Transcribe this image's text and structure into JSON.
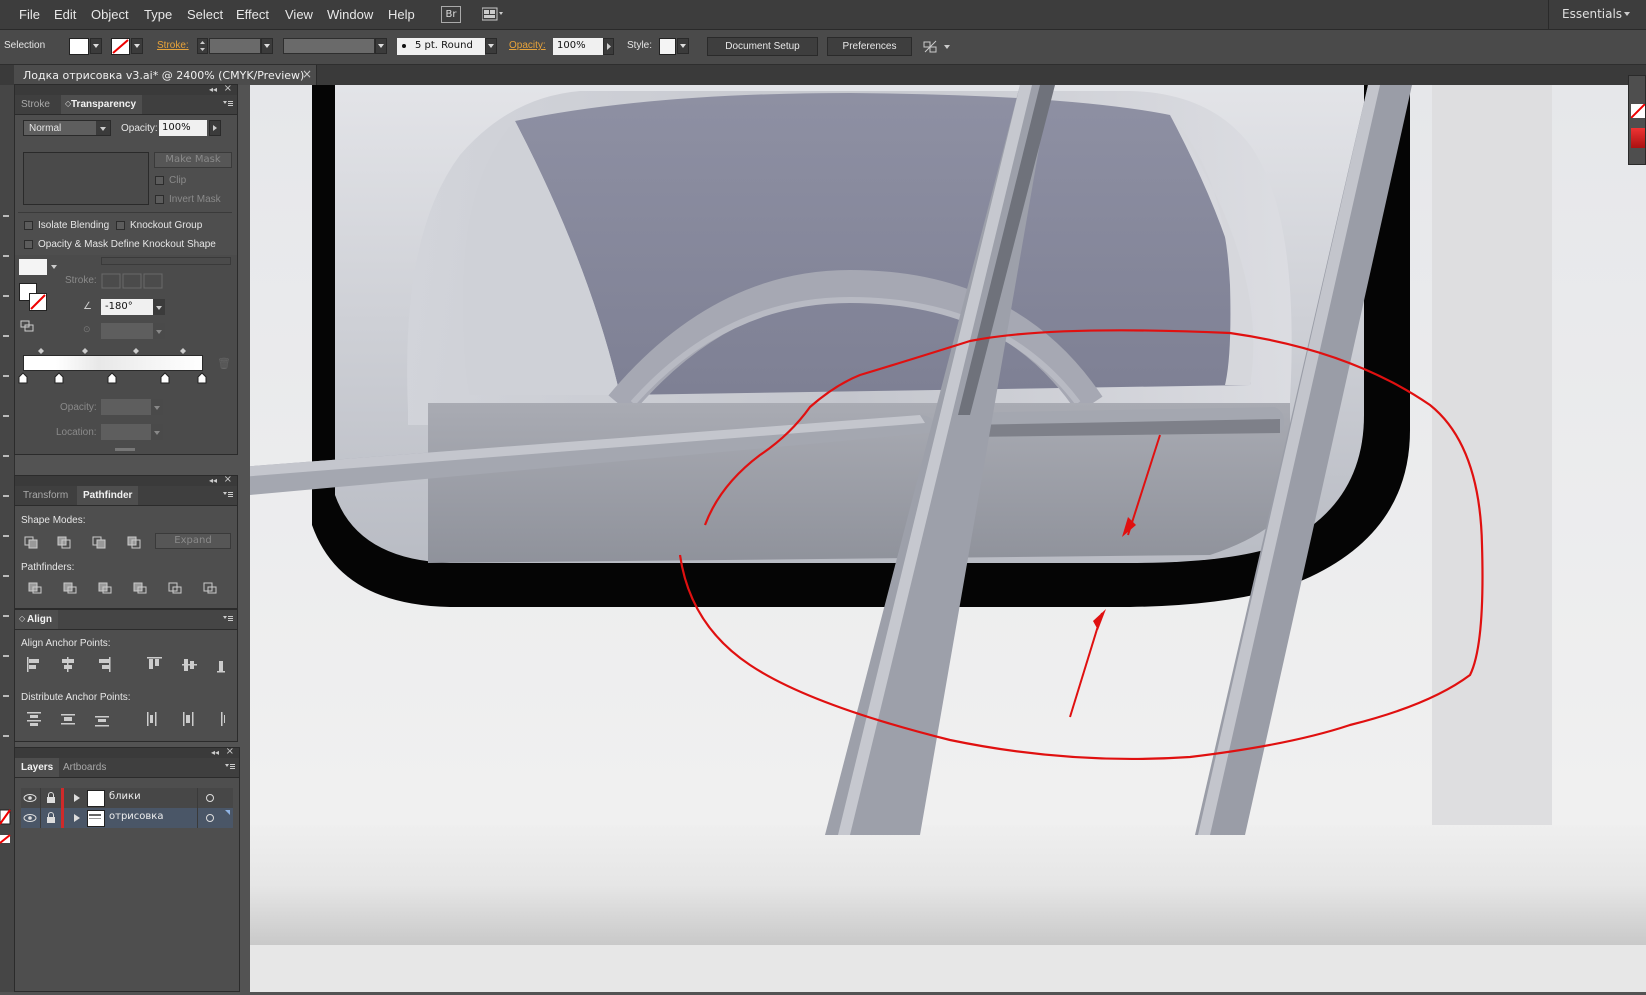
{
  "menubar": {
    "items": [
      "File",
      "Edit",
      "Object",
      "Type",
      "Select",
      "Effect",
      "View",
      "Window",
      "Help"
    ],
    "bridge": "Br",
    "workspace": "Essentials"
  },
  "controlbar": {
    "tool": "Selection",
    "stroke_label": "Stroke:",
    "brush": "5 pt. Round",
    "opacity_label": "Opacity:",
    "opacity_value": "100%",
    "style_label": "Style:",
    "document_setup": "Document Setup",
    "preferences": "Preferences"
  },
  "document": {
    "tab_title": "Лодка отрисовка v3.ai* @ 2400% (CMYK/Preview)"
  },
  "transparency_panel": {
    "tabs": [
      "Stroke",
      "Transparency"
    ],
    "blend_mode": "Normal",
    "opacity_label": "Opacity:",
    "opacity_value": "100%",
    "make_mask": "Make Mask",
    "clip": "Clip",
    "invert_mask": "Invert Mask",
    "isolate_blending": "Isolate Blending",
    "knockout_group": "Knockout Group",
    "opacity_mask_define": "Opacity & Mask Define Knockout Shape"
  },
  "gradient_panel": {
    "stroke_label": "Stroke:",
    "angle_value": "-180°",
    "opacity_label": "Opacity:",
    "location_label": "Location:"
  },
  "pathfinder_panel": {
    "tabs": [
      "Transform",
      "Pathfinder"
    ],
    "shape_modes": "Shape Modes:",
    "expand": "Expand",
    "pathfinders": "Pathfinders:"
  },
  "align_panel": {
    "title": "Align",
    "align_anchor": "Align Anchor Points:",
    "distribute_anchor": "Distribute Anchor Points:"
  },
  "layers_panel": {
    "tabs": [
      "Layers",
      "Artboards"
    ],
    "layers": [
      {
        "name": "блики",
        "color": "#cf2a2a"
      },
      {
        "name": "отрисовка",
        "color": "#cf2a2a"
      }
    ]
  },
  "colors": {
    "annotation_red": "#e01010",
    "ui_dark": "#3d3d3d",
    "highlight_orange": "#e8a33a"
  }
}
